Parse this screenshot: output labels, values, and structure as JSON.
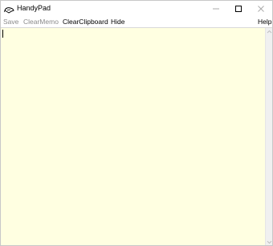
{
  "window": {
    "title": "HandyPad",
    "icons": {
      "app": "handypad-app-icon",
      "minimize": "minimize-icon",
      "maximize": "maximize-icon",
      "close": "close-icon"
    }
  },
  "menu": {
    "save": "Save",
    "clear_memo": "ClearMemo",
    "clear_clipboard": "ClearClipboard",
    "hide": "Hide",
    "help": "Help"
  },
  "editor": {
    "value": "",
    "background": "#ffffe1"
  },
  "colors": {
    "menu_disabled": "#8a8a8a",
    "menu_enabled": "#000000"
  }
}
